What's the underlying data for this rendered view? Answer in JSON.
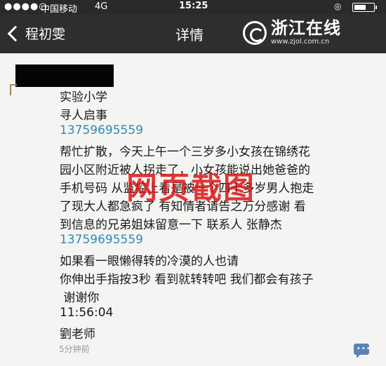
{
  "status_bar": {
    "signal_dots": "●●●●○",
    "carrier": "中国移动",
    "network": "4G",
    "time": "15:25",
    "alarm_icon": "alarm-icon"
  },
  "nav": {
    "back_label": "程初雯",
    "title": "详情",
    "logo_name": "浙江在线",
    "logo_url": "www.zjol.com.cn"
  },
  "post": {
    "lines": [
      "实验小学",
      "寻人启事",
      "13759695559",
      "帮忙扩散，今天上午一个三岁多小女孩在锦绣花",
      "园小区附近被人拐走了，小女孩能说出她爸爸的",
      "手机号码 从监控上看是被一个四十多岁男人抱走",
      "了现大人都急疯了 有知情者请告之万分感谢 看",
      "到信息的兄弟姐妹留意一下 联系人 张静杰",
      "13759695559",
      "如果看一眼懒得转的冷漠的人也请",
      "你伸出手指按3秒 看到就转转吧 我们都会有孩子",
      " 谢谢你",
      "11:56:04",
      "劉老师"
    ],
    "watermark": "网页截图",
    "timestamp": "5分钟前",
    "comment_glyph": "•••"
  },
  "colors": {
    "nav_background": "#2e2e31",
    "phone_link": "#2f8bb8",
    "watermark": "#dc1414",
    "comment_icon": "#5b84b3"
  }
}
